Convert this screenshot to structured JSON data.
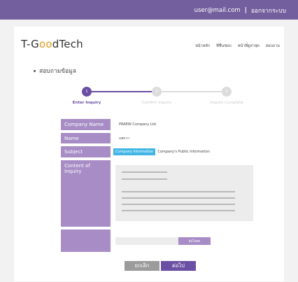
{
  "topbar": {
    "user_email": "user@mail.com",
    "separator": "|",
    "logout_label": "ออกจากระบบ",
    "color": "#735f9e"
  },
  "logo": {
    "prefix": "T-G",
    "accent": "oo",
    "suffix": "dTech",
    "accent_color": "#e89b1c"
  },
  "nav": {
    "items": [
      "หน้าหลัก",
      "ที่ชื่นชอบ",
      "หน้าที่ดูล่าสุด",
      "สอบถาม"
    ]
  },
  "page": {
    "section_title": "สอบถามข้อมูล"
  },
  "steps": [
    {
      "number": "1",
      "label": "Enter Inquiry",
      "active": true
    },
    {
      "number": "2",
      "label": "Confirm Inquiry",
      "active": false
    },
    {
      "number": "3",
      "label": "Inquiry Complete",
      "active": false
    }
  ],
  "form": {
    "company_name": {
      "label": "Company Name",
      "value": "PRAEW Company Ltd."
    },
    "name": {
      "label": "Name",
      "value": "แพรวา"
    },
    "subject": {
      "label": "Subject",
      "tag": "Company Information",
      "value": "Company's Public information"
    },
    "content": {
      "label": "Content of Inquiry"
    },
    "upload": {
      "button_label": "อัปโหลด"
    }
  },
  "buttons": {
    "cancel": "ยกเลิก",
    "next": "ต่อไป"
  },
  "colors": {
    "label_bg": "#a78cc6",
    "step_active": "#6b4fa3",
    "step_inactive": "#dcdcdc",
    "tag_bg": "#41b6e6"
  }
}
